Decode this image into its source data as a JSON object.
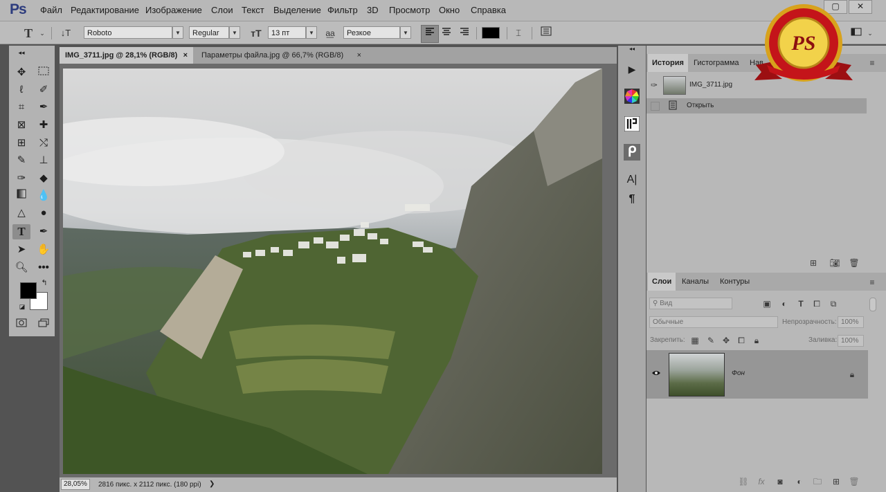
{
  "app": {
    "logo": "Ps"
  },
  "menu": [
    "Файл",
    "Редактирование",
    "Изображение",
    "Слои",
    "Текст",
    "Выделение",
    "Фильтр",
    "3D",
    "Просмотр",
    "Окно",
    "Справка"
  ],
  "window_controls": {
    "minimize": "—",
    "restore": "▢",
    "close": "✕"
  },
  "options": {
    "font_family": "Roboto",
    "font_style": "Regular",
    "font_size": "13 пт",
    "antialias_label": "a͟a",
    "antialias": "Резкое",
    "text_color": "#000000"
  },
  "document_tabs": [
    {
      "label": "IMG_3711.jpg @ 28,1% (RGB/8)",
      "close": "×"
    },
    {
      "label": "Параметры файла.jpg @ 66,7% (RGB/8)",
      "close": "×"
    }
  ],
  "status": {
    "zoom": "28,05%",
    "doc_info": "2816 пикс. x 2112 пикс. (180 ppi)",
    "arrow": "❯"
  },
  "history_panel": {
    "tabs": [
      "История",
      "Гистограмма",
      "Нав"
    ],
    "snapshot": "IMG_3711.jpg",
    "steps": [
      "Открыть"
    ]
  },
  "layers_panel": {
    "tabs": [
      "Слои",
      "Каналы",
      "Контуры"
    ],
    "filter_placeholder": "Вид",
    "blend_mode": "Обычные",
    "opacity_label": "Непрозрачность:",
    "opacity_value": "100%",
    "lock_label": "Закрепить:",
    "fill_label": "Заливка:",
    "fill_value": "100%",
    "layers": [
      {
        "name": "Фон",
        "visible": true,
        "locked": true
      }
    ]
  },
  "badge": {
    "text": "PS"
  },
  "colors": {
    "foreground": "#000000",
    "background": "#ffffff"
  }
}
